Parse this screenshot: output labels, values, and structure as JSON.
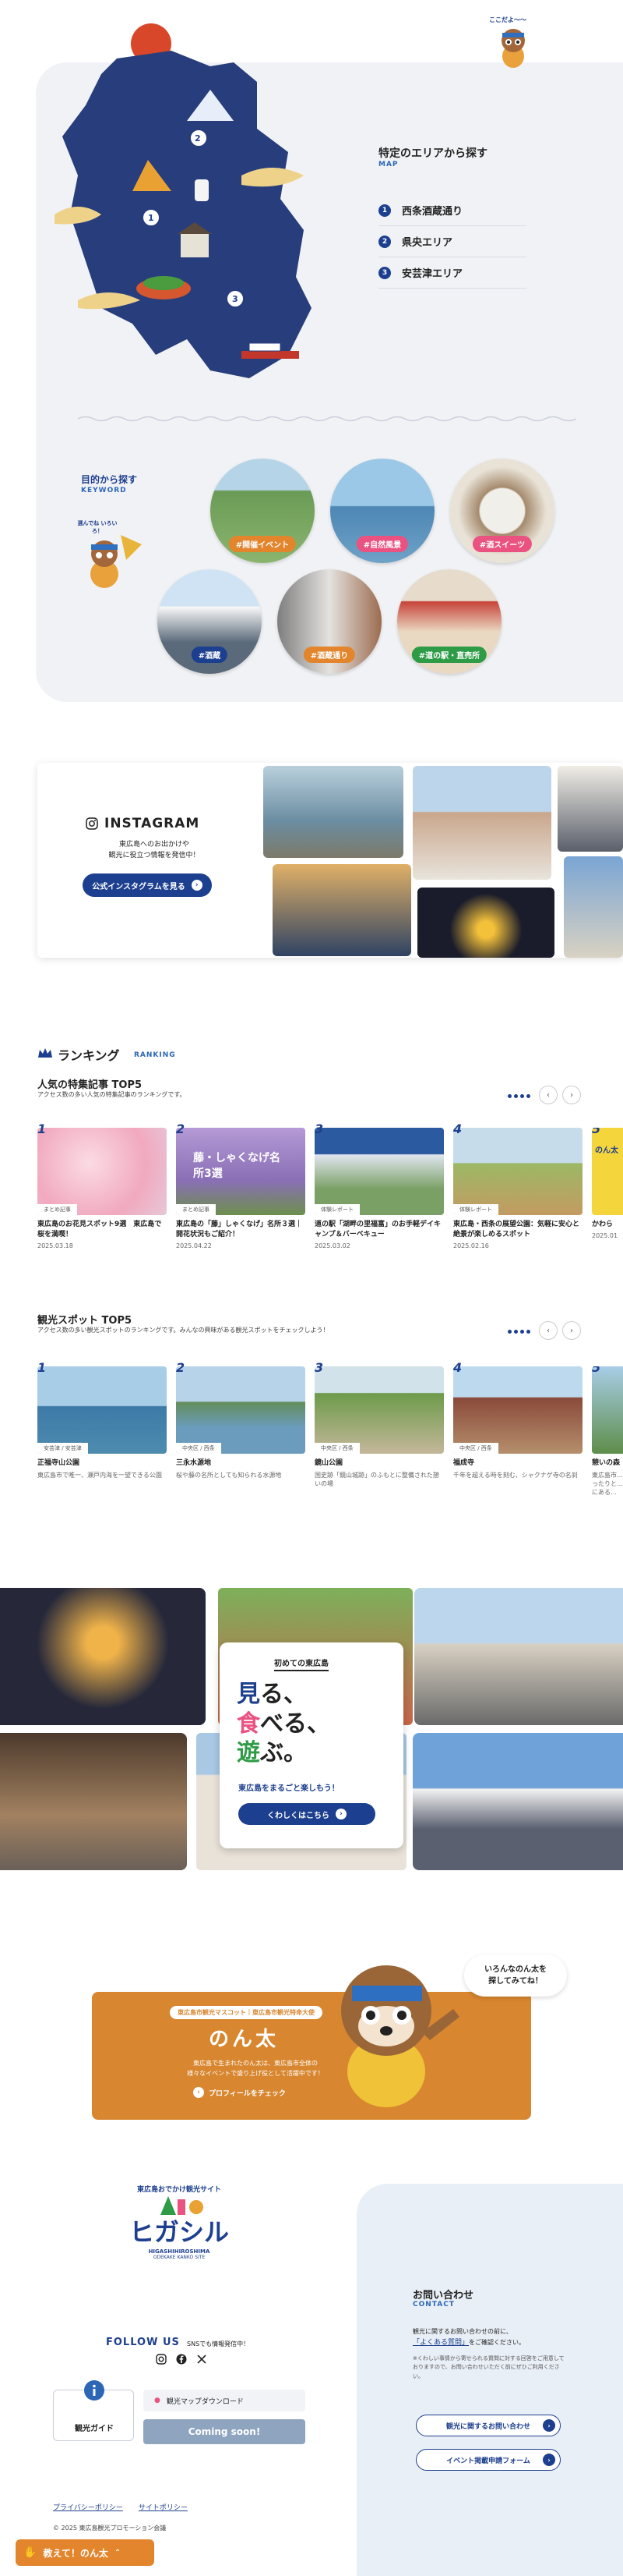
{
  "map_section": {
    "speech": "ここだよ〜〜",
    "title": "特定のエリアから探す",
    "subtitle": "MAP",
    "map_numbers": [
      "1",
      "2",
      "3"
    ],
    "areas": [
      {
        "num": "1",
        "label": "西条酒蔵通り"
      },
      {
        "num": "2",
        "label": "県央エリア"
      },
      {
        "num": "3",
        "label": "安芸津エリア"
      }
    ]
  },
  "keyword_section": {
    "title": "目的から探す",
    "subtitle": "KEYWORD",
    "mascot_speech": "選んでね いろいろ！",
    "keywords": [
      "#開催イベント",
      "#自然風景",
      "#酒スイーツ",
      "#酒蔵",
      "#酒蔵通り",
      "#道の駅・直売所"
    ]
  },
  "instagram": {
    "title": "INSTAGRAM",
    "desc_line1": "東広島へのお出かけや",
    "desc_line2": "観光に役立つ情報を発信中！",
    "button": "公式インスタグラムを見る"
  },
  "ranking": {
    "heading": "ランキング",
    "heading_en": "RANKING",
    "features": {
      "title": "人気の特集記事 TOP5",
      "desc": "アクセス数の多い人気の特集記事のランキングです。",
      "items": [
        {
          "rank": "1",
          "category": "まとめ記事",
          "title": "東広島のお花見スポット9選　東広島で桜を満喫！",
          "date": "2025.03.18",
          "img_text": ""
        },
        {
          "rank": "2",
          "category": "まとめ記事",
          "title": "東広島の「藤」しゃくなげ」名所３選｜開花状況もご紹介！",
          "date": "2025.04.22",
          "img_text": "藤・しゃくなげ名所3選"
        },
        {
          "rank": "3",
          "category": "体験レポート",
          "title": "道の駅「湖畔の里福富」のお手軽デイキャンプ＆バーベキュー",
          "date": "2025.03.02",
          "img_text": ""
        },
        {
          "rank": "4",
          "category": "体験レポート",
          "title": "東広島・西条の展望公園：気軽に安心と絶景が楽しめるスポット",
          "date": "2025.02.16",
          "img_text": ""
        },
        {
          "rank": "5",
          "category": "",
          "title": "かわら",
          "date": "2025.01",
          "img_text": "のん太"
        }
      ]
    },
    "spots": {
      "title": "観光スポット TOP5",
      "desc": "アクセス数の多い観光スポットのランキングです。みんなの興味がある観光スポットをチェックしよう！",
      "items": [
        {
          "rank": "1",
          "area": "安芸津 / 安芸津",
          "title": "正福寺山公園",
          "desc": "東広島市で唯一、瀬戸内海を一望できる公園"
        },
        {
          "rank": "2",
          "area": "中央区 / 西条",
          "title": "三永水源地",
          "desc": "桜や藤の名所としても知られる水源地"
        },
        {
          "rank": "3",
          "area": "中央区 / 西条",
          "title": "鏡山公園",
          "desc": "国史跡「鏡山城跡」のふもとに整備された憩いの場"
        },
        {
          "rank": "4",
          "area": "中央区 / 西条",
          "title": "福成寺",
          "desc": "千年を超える時を刻む、シャクナゲ寺の名刹"
        },
        {
          "rank": "5",
          "area": "",
          "title": "憩いの森",
          "desc": "東広島市…ったりと…にある…"
        }
      ]
    }
  },
  "intro": {
    "tag": "初めての東広島",
    "line1_char": "見",
    "line1_rest": "る、",
    "line2_char": "食",
    "line2_rest": "べる、",
    "line3_char": "遊",
    "line3_rest": "ぶ。",
    "sub": "東広島をまるごと楽しもう！",
    "button": "くわしくはこちら"
  },
  "nonta": {
    "badge": "東広島市観光マスコット｜東広島市観光特命大使",
    "name": "のん太",
    "desc_line1": "東広島で生まれたのん太は、東広島市全体の",
    "desc_line2": "様々なイベントで盛り上げ役として活躍中です！",
    "button": "プロフィールをチェック",
    "speech_line1": "いろんなのん太を",
    "speech_line2": "探してみてね！"
  },
  "footer": {
    "logo_top": "東広島おでかけ観光サイト",
    "logo_main": "ヒガシル",
    "logo_en": "HIGASHIHIROSHIMA",
    "logo_en2": "ODEKAKE KANKO SITE",
    "follow": "FOLLOW US",
    "follow_sub": "SNSでも情報発信中！",
    "guide_label": "観光ガイド",
    "download_label": "観光マップダウンロード",
    "coming_label": "Coming soon!",
    "privacy": "プライバシーポリシー",
    "sitepolicy": "サイトポリシー",
    "copyright": "© 2025 東広島観光プロモーション会議",
    "contact_title": "お問い合わせ",
    "contact_en": "CONTACT",
    "contact_desc_1": "観光に関するお問い合わせの前に、",
    "contact_desc_link": "「よくある質問」",
    "contact_desc_2": "をご確認ください。",
    "contact_note": "※くわしい事情から寄せられる質問に対する回答をご用意しておりますので、お問い合わせいただく前にぜひご利用ください。",
    "contact_btn1": "観光に関するお問い合わせ",
    "contact_btn2": "イベント掲載申請フォーム",
    "oshiete": "教えて！のん太"
  },
  "colors": {
    "navy": "#1d3f8f",
    "pink": "#ea5281",
    "orange": "#e2852c",
    "green": "#2e9b47",
    "sun": "#d9472b"
  }
}
